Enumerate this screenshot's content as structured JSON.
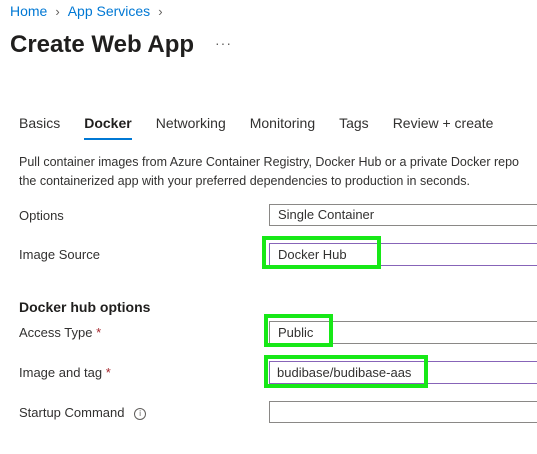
{
  "breadcrumb": {
    "home": "Home",
    "separator": ">",
    "app_services": "App Services"
  },
  "page": {
    "title": "Create Web App",
    "more": "···"
  },
  "tabs": [
    {
      "label": "Basics",
      "active": false
    },
    {
      "label": "Docker",
      "active": true
    },
    {
      "label": "Networking",
      "active": false
    },
    {
      "label": "Monitoring",
      "active": false
    },
    {
      "label": "Tags",
      "active": false
    },
    {
      "label": "Review + create",
      "active": false
    }
  ],
  "intro": {
    "line1": "Pull container images from Azure Container Registry, Docker Hub or a private Docker repo",
    "line2": "the containerized app with your preferred dependencies to production in seconds."
  },
  "form": {
    "options": {
      "label": "Options",
      "value": "Single Container"
    },
    "image_source": {
      "label": "Image Source",
      "value": "Docker Hub"
    },
    "section_title": "Docker hub options",
    "access_type": {
      "label": "Access Type",
      "required": "*",
      "value": "Public"
    },
    "image_tag": {
      "label": "Image and tag",
      "required": "*",
      "value": "budibase/budibase-aas"
    },
    "startup_command": {
      "label": "Startup Command",
      "info": "i",
      "value": ""
    }
  },
  "colors": {
    "accent": "#0078d4",
    "highlight": "#17e817",
    "required": "#a4262c",
    "field_border_active": "#8764b8"
  }
}
